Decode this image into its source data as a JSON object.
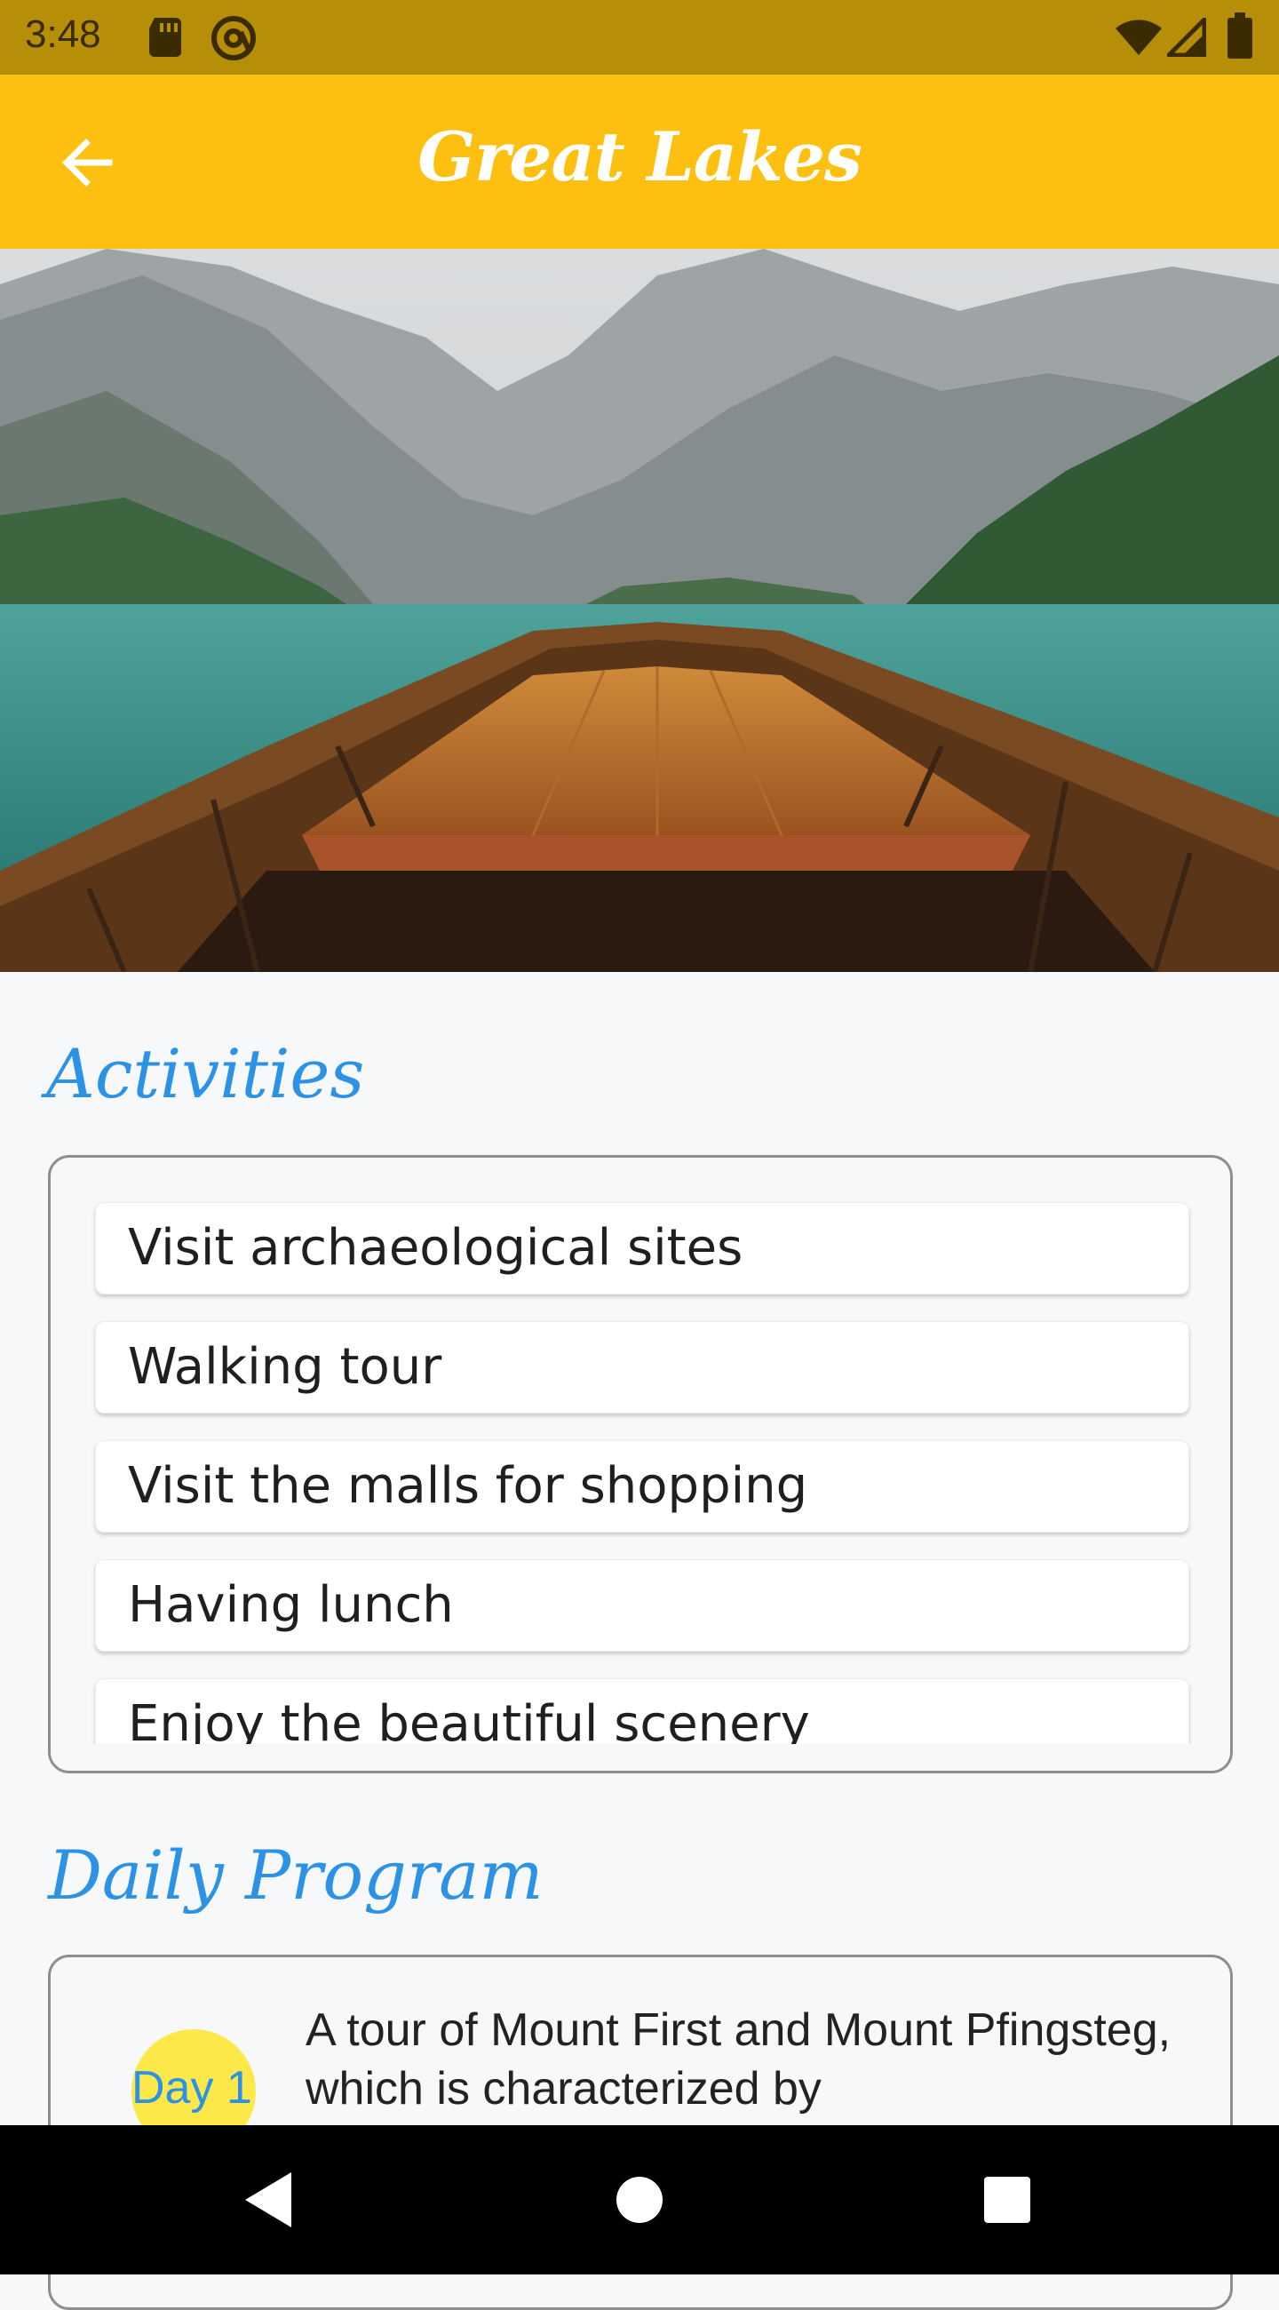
{
  "status_bar": {
    "time": "3:48",
    "left_icons": [
      "sd-card-icon",
      "at-sign-icon"
    ],
    "right_icons": [
      "wifi-icon",
      "cellular-signal-icon",
      "battery-icon"
    ]
  },
  "app_bar": {
    "back_icon": "arrow-left-icon",
    "title": "Great Lakes",
    "background_color": "#fdc010",
    "title_color": "#ffffff"
  },
  "hero": {
    "description": "mountain-lake-boat-photo"
  },
  "activities": {
    "title": "Activities",
    "items": [
      "Visit archaeological sites",
      "Walking tour",
      "Visit the malls for shopping",
      "Having lunch",
      "Enjoy the beautiful scenery"
    ]
  },
  "daily_program": {
    "title": "Daily Program",
    "entries": [
      {
        "day": "Day 1",
        "text": "A tour of Mount First and Mount Pfingsteg, which is characterized by"
      }
    ]
  },
  "colors": {
    "accent": "#2c92e6",
    "status_bar": "#b78e08",
    "day_badge": "#fde84a"
  },
  "nav_bar": {
    "icons": [
      "back-triangle-icon",
      "home-circle-icon",
      "recents-square-icon"
    ]
  }
}
